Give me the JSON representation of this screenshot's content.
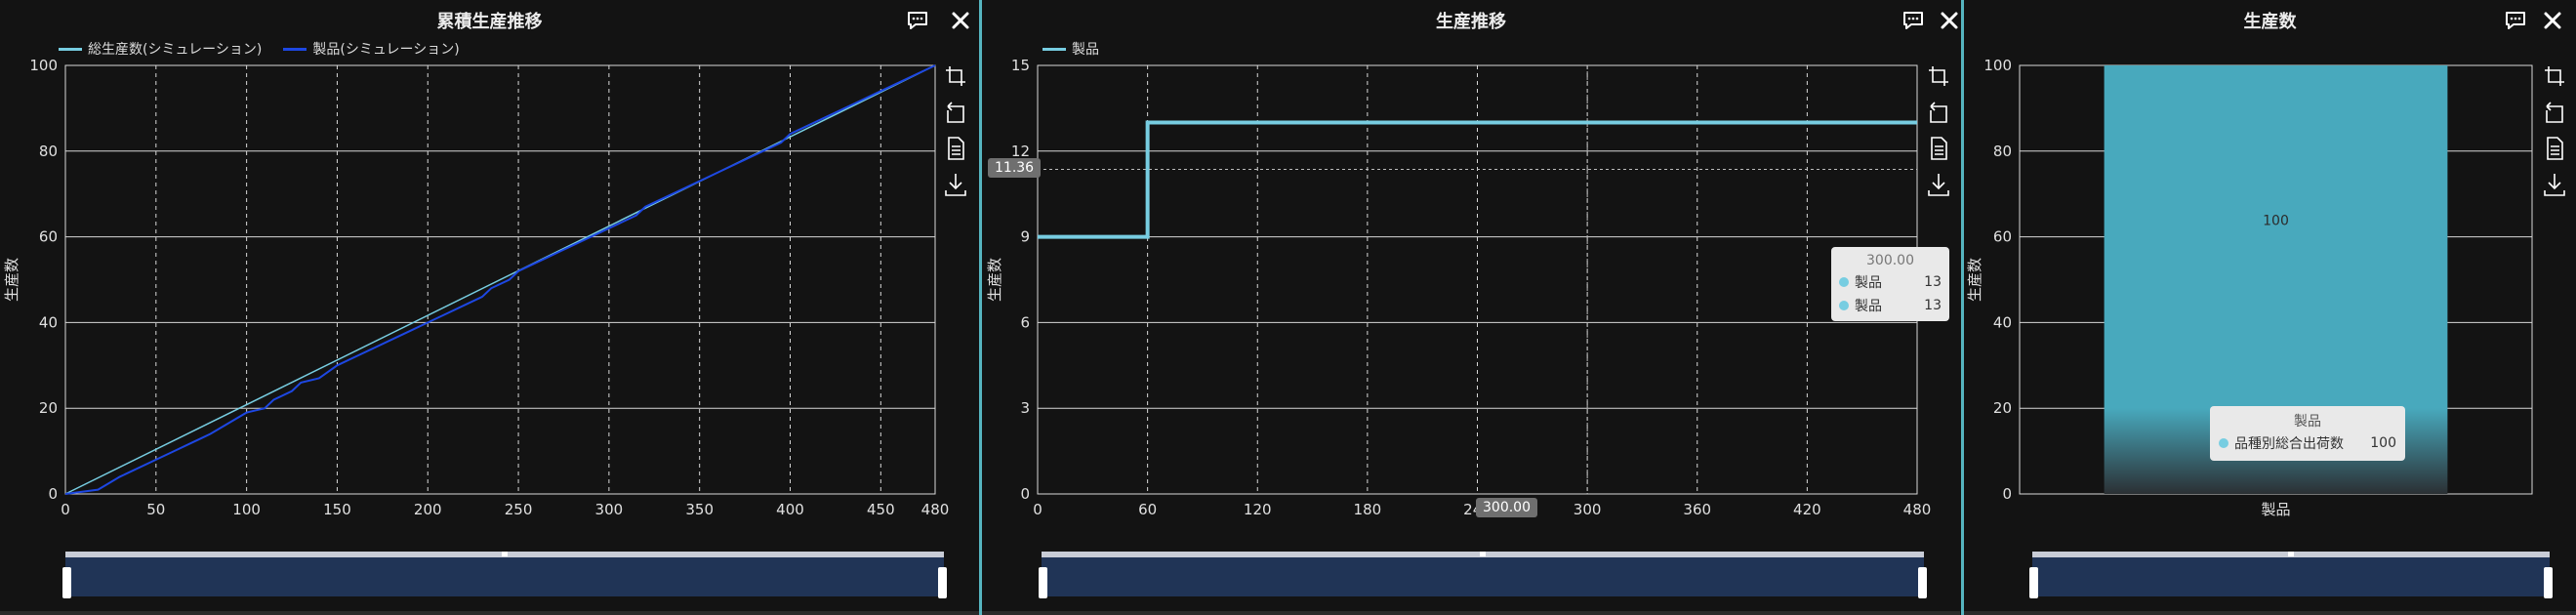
{
  "colors": {
    "background": "#131313",
    "accent_divider": "#56b5c0",
    "cumulative_line": "#1d47e2",
    "step_line": "#77cde1",
    "bar_top": "#48a9bd",
    "slider_fill": "#203456"
  },
  "icons": {
    "comment": "comment-icon",
    "close": "close-icon",
    "toolbox": [
      "zoom-icon",
      "zoom-reset-icon",
      "data-view-icon",
      "save-image-icon"
    ]
  },
  "panels": [
    {
      "title": "累積生産推移",
      "legend": [
        "総生産数(シミュレーション)",
        "製品(シミュレーション)"
      ]
    },
    {
      "title": "生産推移",
      "legend": [
        "製品"
      ],
      "crosshair": {
        "y_label": "11.36",
        "x_label": "300.00"
      },
      "tooltip": {
        "header": "300.00",
        "rows": [
          {
            "name": "製品",
            "value": "13"
          },
          {
            "name": "製品",
            "value": "13"
          }
        ]
      }
    },
    {
      "title": "生産数",
      "tooltip": {
        "header": "製品",
        "rows": [
          {
            "name": "品種別総合出荷数",
            "value": "100"
          }
        ]
      }
    }
  ],
  "chart_data": [
    {
      "type": "line",
      "title": "累積生産推移",
      "xlabel": "",
      "ylabel": "生産数",
      "xlim": [
        0,
        480
      ],
      "ylim": [
        0,
        100
      ],
      "x_ticks": [
        0,
        50,
        100,
        150,
        200,
        250,
        300,
        350,
        400,
        450,
        480
      ],
      "y_ticks": [
        0,
        20,
        40,
        60,
        80,
        100
      ],
      "grid": "x dashed, y solid",
      "legend": "top-left",
      "series": [
        {
          "name": "総生産数(シミュレーション)",
          "x": [
            0,
            480
          ],
          "y": [
            0,
            100
          ]
        },
        {
          "name": "製品(シミュレーション)",
          "x": [
            0,
            18,
            22,
            30,
            50,
            55,
            60,
            70,
            75,
            80,
            100,
            110,
            115,
            125,
            130,
            140,
            150,
            160,
            170,
            180,
            190,
            200,
            210,
            220,
            230,
            235,
            245,
            250,
            255,
            265,
            275,
            285,
            295,
            305,
            315,
            320,
            330,
            340,
            350,
            360,
            370,
            375,
            385,
            395,
            400,
            410,
            420,
            430,
            440,
            450,
            460,
            470,
            480
          ],
          "y": [
            0,
            1,
            2,
            4,
            8,
            9,
            10,
            12,
            13,
            14,
            19,
            20,
            22,
            24,
            26,
            27,
            30,
            32,
            34,
            36,
            38,
            40,
            42,
            44,
            46,
            48,
            50,
            52,
            53,
            55,
            57,
            59,
            61,
            63,
            65,
            67,
            69,
            71,
            73,
            75,
            77,
            78,
            80,
            82,
            84,
            86,
            88,
            90,
            92,
            94,
            96,
            98,
            100
          ]
        }
      ]
    },
    {
      "type": "line",
      "title": "生産推移",
      "xlabel": "",
      "ylabel": "生産数",
      "xlim": [
        0,
        480
      ],
      "ylim": [
        0,
        15
      ],
      "x_ticks": [
        0,
        60,
        120,
        180,
        240,
        300,
        360,
        420,
        480
      ],
      "y_ticks": [
        0,
        3,
        6,
        9,
        12,
        15
      ],
      "grid": "x dashed, y solid",
      "legend": "top-left",
      "step": true,
      "series": [
        {
          "name": "製品",
          "x": [
            0,
            60,
            60,
            480
          ],
          "y": [
            9,
            9,
            13,
            13
          ]
        }
      ]
    },
    {
      "type": "bar",
      "title": "生産数",
      "xlabel": "",
      "ylabel": "生産数",
      "ylim": [
        0,
        100
      ],
      "y_ticks": [
        0,
        20,
        40,
        60,
        80,
        100
      ],
      "categories": [
        "製品"
      ],
      "series": [
        {
          "name": "品種別総合出荷数",
          "values": [
            100
          ]
        }
      ],
      "data_labels": [
        "100"
      ]
    }
  ]
}
